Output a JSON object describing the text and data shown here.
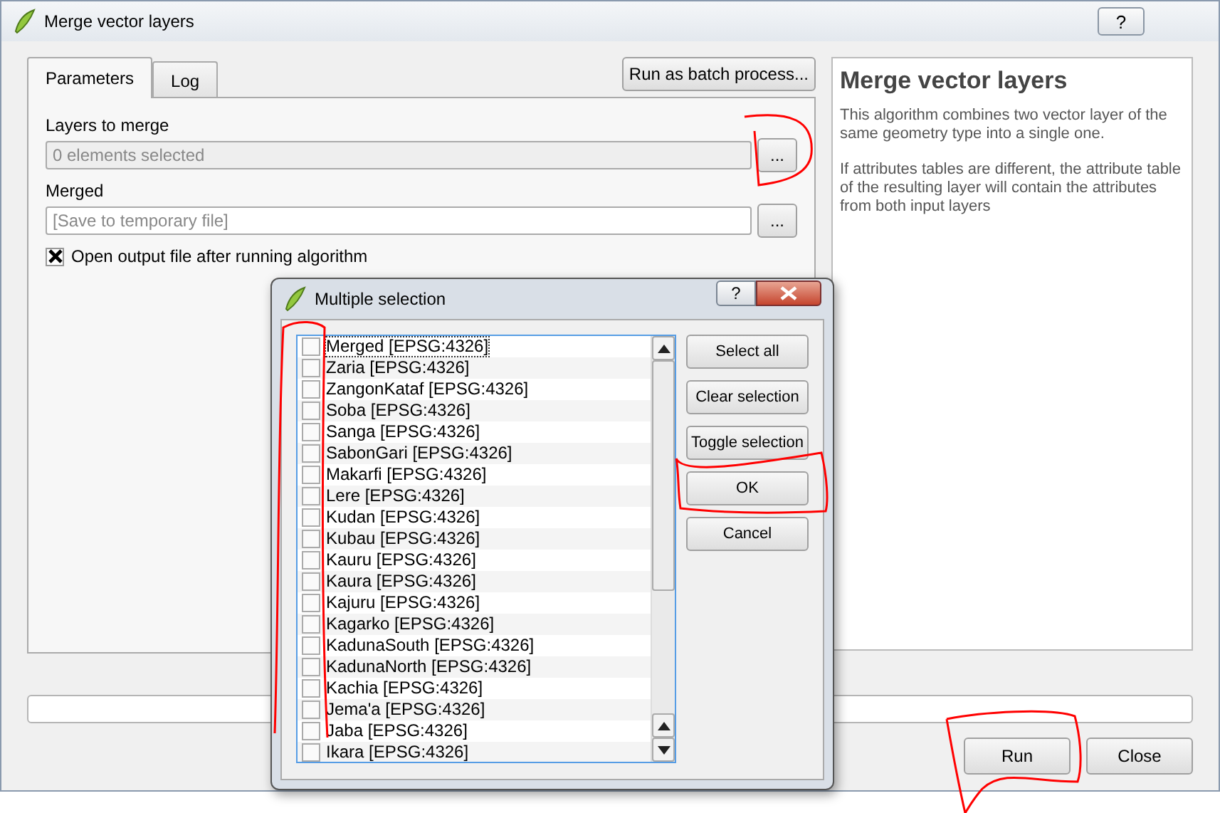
{
  "window": {
    "title": "Merge vector layers",
    "help_button": "?"
  },
  "tabs": [
    {
      "label": "Parameters",
      "selected": true
    },
    {
      "label": "Log",
      "selected": false
    }
  ],
  "batch_button": "Run as batch process...",
  "parameters": [
    {
      "kind": "multi",
      "label": "Layers to merge",
      "value": "0 elements selected",
      "button": "..."
    },
    {
      "kind": "output",
      "label": "Merged",
      "placeholder": "[Save to temporary file]",
      "button": "..."
    }
  ],
  "open_output": {
    "label": "Open output file after running algorithm",
    "checked": true
  },
  "help": {
    "title": "Merge vector layers",
    "paragraphs": [
      "This algorithm combines two vector layer of the same geometry type into a single one.",
      "If attributes tables are different, the attribute table of the resulting layer will contain the attributes from both input layers"
    ]
  },
  "progress": {
    "level": 0
  },
  "buttons": [
    "Run",
    "Close"
  ],
  "dialog": {
    "title": "Multiple selection",
    "help_button": "?",
    "items": [
      {
        "label": "Merged [EPSG:4326]",
        "checked": false
      },
      {
        "label": "Zaria [EPSG:4326]",
        "checked": false
      },
      {
        "label": "ZangonKataf [EPSG:4326]",
        "checked": false
      },
      {
        "label": "Soba [EPSG:4326]",
        "checked": false
      },
      {
        "label": "Sanga [EPSG:4326]",
        "checked": false
      },
      {
        "label": "SabonGari [EPSG:4326]",
        "checked": false
      },
      {
        "label": "Makarfi [EPSG:4326]",
        "checked": false
      },
      {
        "label": "Lere [EPSG:4326]",
        "checked": false
      },
      {
        "label": "Kudan [EPSG:4326]",
        "checked": false
      },
      {
        "label": "Kubau [EPSG:4326]",
        "checked": false
      },
      {
        "label": "Kauru [EPSG:4326]",
        "checked": false
      },
      {
        "label": "Kaura [EPSG:4326]",
        "checked": false
      },
      {
        "label": "Kajuru [EPSG:4326]",
        "checked": false
      },
      {
        "label": "Kagarko [EPSG:4326]",
        "checked": false
      },
      {
        "label": "KadunaSouth [EPSG:4326]",
        "checked": false
      },
      {
        "label": "KadunaNorth [EPSG:4326]",
        "checked": false
      },
      {
        "label": "Kachia [EPSG:4326]",
        "checked": false
      },
      {
        "label": "Jema'a [EPSG:4326]",
        "checked": false
      },
      {
        "label": "Jaba [EPSG:4326]",
        "checked": false
      },
      {
        "label": "Ikara [EPSG:4326]",
        "checked": false
      }
    ],
    "buttons": [
      "Select all",
      "Clear selection",
      "Toggle selection",
      "OK",
      "Cancel"
    ]
  }
}
